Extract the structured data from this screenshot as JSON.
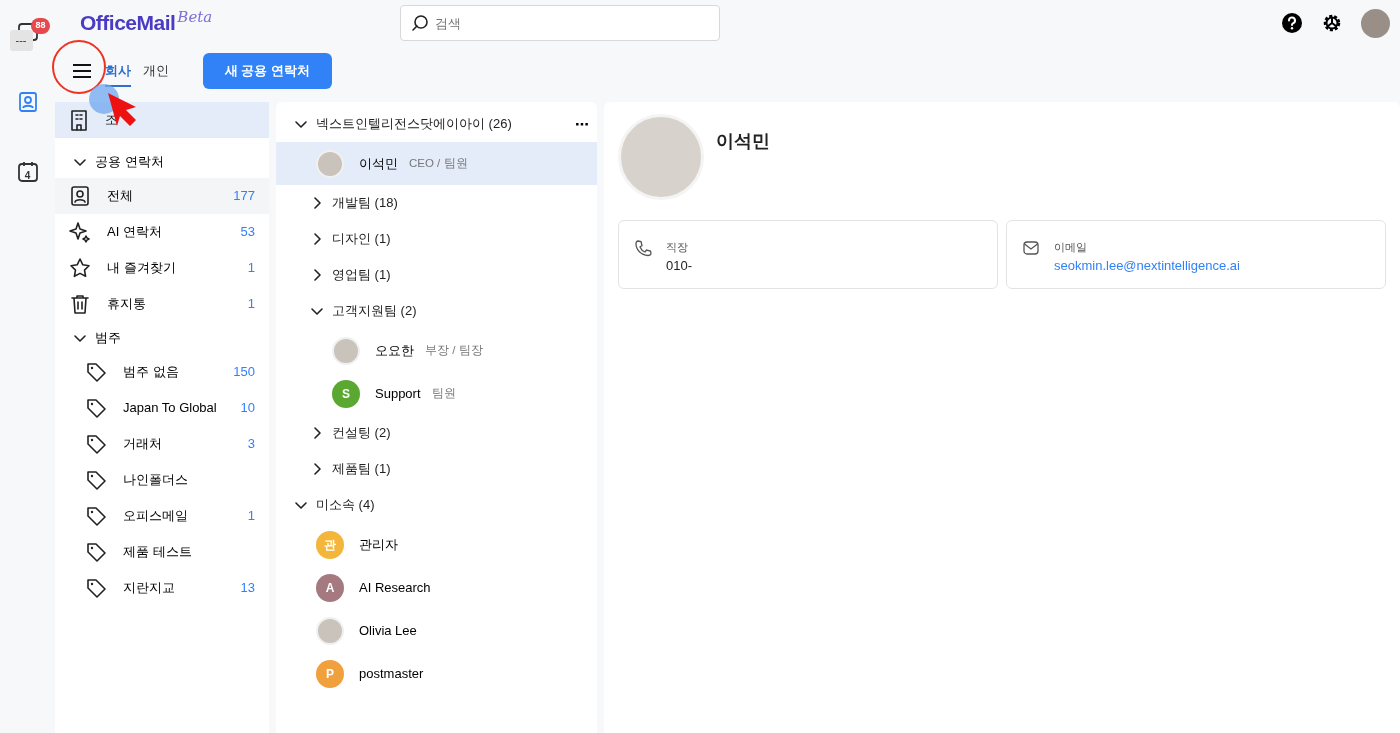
{
  "app": {
    "logo": "OfficeMail",
    "logo_tag": "Beta"
  },
  "rail": [
    {
      "kind": "mail",
      "badge": "88",
      "tooltip": "---",
      "selected": false
    },
    {
      "kind": "contacts",
      "selected": true
    },
    {
      "kind": "calendar",
      "day": "4",
      "selected": false
    }
  ],
  "search": {
    "placeholder": "검색"
  },
  "tabs": [
    {
      "label": "회사",
      "selected": true
    },
    {
      "label": "개인",
      "selected": false
    }
  ],
  "new_button": "새 공용 연락처",
  "sidebar": {
    "top_item": {
      "label": "조",
      "selected": true
    },
    "sections": [
      {
        "title": "공용 연락처",
        "expanded": true,
        "items": [
          {
            "label": "전체",
            "count": "177",
            "selected": true
          },
          {
            "label": "AI 연락처",
            "count": "53",
            "selected": false
          },
          {
            "label": "내 즐겨찾기",
            "count": "1",
            "selected": false
          },
          {
            "label": "휴지통",
            "count": "1",
            "selected": false
          }
        ]
      },
      {
        "title": "범주",
        "expanded": true,
        "items": [
          {
            "label": "범주 없음",
            "count": "150",
            "selected": false
          },
          {
            "label": "Japan To Global",
            "count": "10",
            "selected": false
          },
          {
            "label": "거래처",
            "count": "3",
            "selected": false
          },
          {
            "label": "나인폴더스",
            "selected": false
          },
          {
            "label": "오피스메일",
            "count": "1",
            "selected": false
          },
          {
            "label": "제품 테스트",
            "selected": false
          },
          {
            "label": "지란지교",
            "count": "13",
            "selected": false
          }
        ]
      }
    ]
  },
  "tree": [
    {
      "kind": "group",
      "label": "넥스트인텔리전스닷에이아이 (26)",
      "expanded": true,
      "more": "⋯",
      "children": [
        {
          "kind": "person",
          "name": "이석민",
          "role": "CEO / 팀원",
          "selected": true
        },
        {
          "kind": "group",
          "label": "개발팀 (18)",
          "expanded": false
        },
        {
          "kind": "group",
          "label": "디자인 (1)",
          "expanded": false
        },
        {
          "kind": "group",
          "label": "영업팀 (1)",
          "expanded": false
        },
        {
          "kind": "group",
          "label": "고객지원팀 (2)",
          "expanded": true,
          "children": [
            {
              "kind": "person",
              "name": "오요한",
              "role": "부장 / 팀장",
              "selected": false
            },
            {
              "kind": "person",
              "name": "Support",
              "role": "팀원",
              "initial": "S",
              "color": "#5aa832",
              "selected": false
            }
          ]
        },
        {
          "kind": "group",
          "label": "컨설팅 (2)",
          "expanded": false
        },
        {
          "kind": "group",
          "label": "제품팀 (1)",
          "expanded": false
        }
      ]
    },
    {
      "kind": "group",
      "label": "미소속 (4)",
      "expanded": true,
      "children": [
        {
          "kind": "person",
          "name": "관리자",
          "initial": "관",
          "color": "#f3b63a",
          "selected": false
        },
        {
          "kind": "person",
          "name": "AI Research",
          "initial": "A",
          "color": "#a47a80",
          "selected": false
        },
        {
          "kind": "person",
          "name": "Olivia Lee",
          "selected": false
        },
        {
          "kind": "person",
          "name": "postmaster",
          "initial": "P",
          "color": "#f0a03c",
          "selected": false
        }
      ]
    }
  ],
  "detail": {
    "name": "이석민",
    "fields": [
      {
        "kind": "phone",
        "label": "직장",
        "value": "010-"
      },
      {
        "kind": "email",
        "label": "이메일",
        "value": "seokmin.lee@nextintelligence.ai"
      }
    ]
  }
}
